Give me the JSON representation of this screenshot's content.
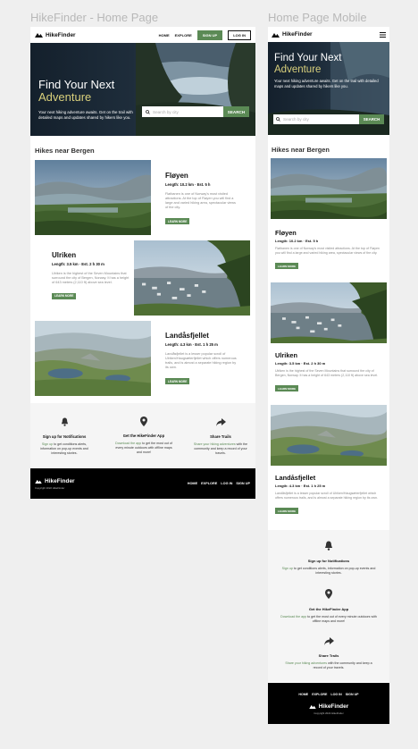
{
  "frames": {
    "desktop_label": "HikeFinder - Home Page",
    "mobile_label": "Home Page Mobile"
  },
  "brand": {
    "name": "HikeFinder",
    "copyright": "Copyright 2022 HikeFinder"
  },
  "nav": {
    "home": "HOME",
    "explore": "EXPLORE",
    "signup": "SIGN UP",
    "login": "LOG IN"
  },
  "hero": {
    "line1": "Find Your Next",
    "line2": "Adventure",
    "subtitle": "Your next hiking adventure awaits. Get on the trail with detailed maps and updates shared by hikers like you.",
    "search_placeholder": "Search by city",
    "search_button": "SEARCH"
  },
  "section": {
    "title": "Hikes near Bergen"
  },
  "hikes": [
    {
      "name": "Fløyen",
      "meta": "Length: 10.2 km · Est. 5 h",
      "desc": "Fløibanen is one of Norway's most visited attractions. At the top of Fløyen you will find a large and varied hiking area, spectacular views of the city.",
      "cta": "LEARN MORE"
    },
    {
      "name": "Ulriken",
      "meta": "Length: 3.5 km · Est. 2 h 30 m",
      "desc": "Ulriken is the highest of the Seven Mountains that surround the city of Bergen, Norway. It has a height of 643 meters (2,110 ft) above sea level.",
      "cta": "LEARN MORE"
    },
    {
      "name": "Landåsfjellet",
      "meta": "Length: 4.3 km · Est. 1 h 25 m",
      "desc": "Landåsfjellet is a lesser popular scroll of Ulriken/Haugsæterfjellet which offers numerous trails, and is almost a separate hiking region by its own.",
      "cta": "LEARN MORE"
    }
  ],
  "features": [
    {
      "title": "Sign up for Notifications",
      "link": "Sign up",
      "rest": " to get conditions alerts, information on pop-up events and interesting stories."
    },
    {
      "title": "Get the HikeFinder App",
      "link": "Download the app",
      "rest": " to get the most out of every minute outdoors with offline maps and more!"
    },
    {
      "title": "Share Trails",
      "link": "Share your hiking adventures",
      "rest": " with the community and keep a record of your travels."
    }
  ],
  "footer": {
    "home": "HOME",
    "explore": "EXPLORE",
    "login": "LOG IN",
    "signup": "SIGN UP"
  }
}
